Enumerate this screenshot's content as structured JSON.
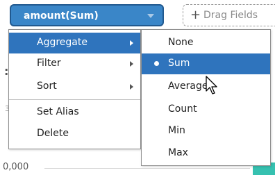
{
  "field_pill": {
    "label": "amount(Sum)"
  },
  "dropzone": {
    "text": "Drag Fields"
  },
  "background": {
    "fragment_a": ":",
    "fragment_b": "3",
    "axis_tick": "0,000"
  },
  "context_menu": {
    "items": [
      {
        "label": "Aggregate",
        "has_submenu": true,
        "highlighted": true
      },
      {
        "label": "Filter",
        "has_submenu": true
      },
      {
        "label": "Sort",
        "has_submenu": true
      },
      {
        "label": "Set Alias"
      },
      {
        "label": "Delete"
      }
    ]
  },
  "aggregate_submenu": {
    "selected": "Sum",
    "items": [
      {
        "label": "None"
      },
      {
        "label": "Sum"
      },
      {
        "label": "Average"
      },
      {
        "label": "Count"
      },
      {
        "label": "Min"
      },
      {
        "label": "Max"
      }
    ]
  },
  "colors": {
    "accent": "#3a86c8",
    "selection": "#2f74bd",
    "chart_bar": "#36c1b0"
  }
}
